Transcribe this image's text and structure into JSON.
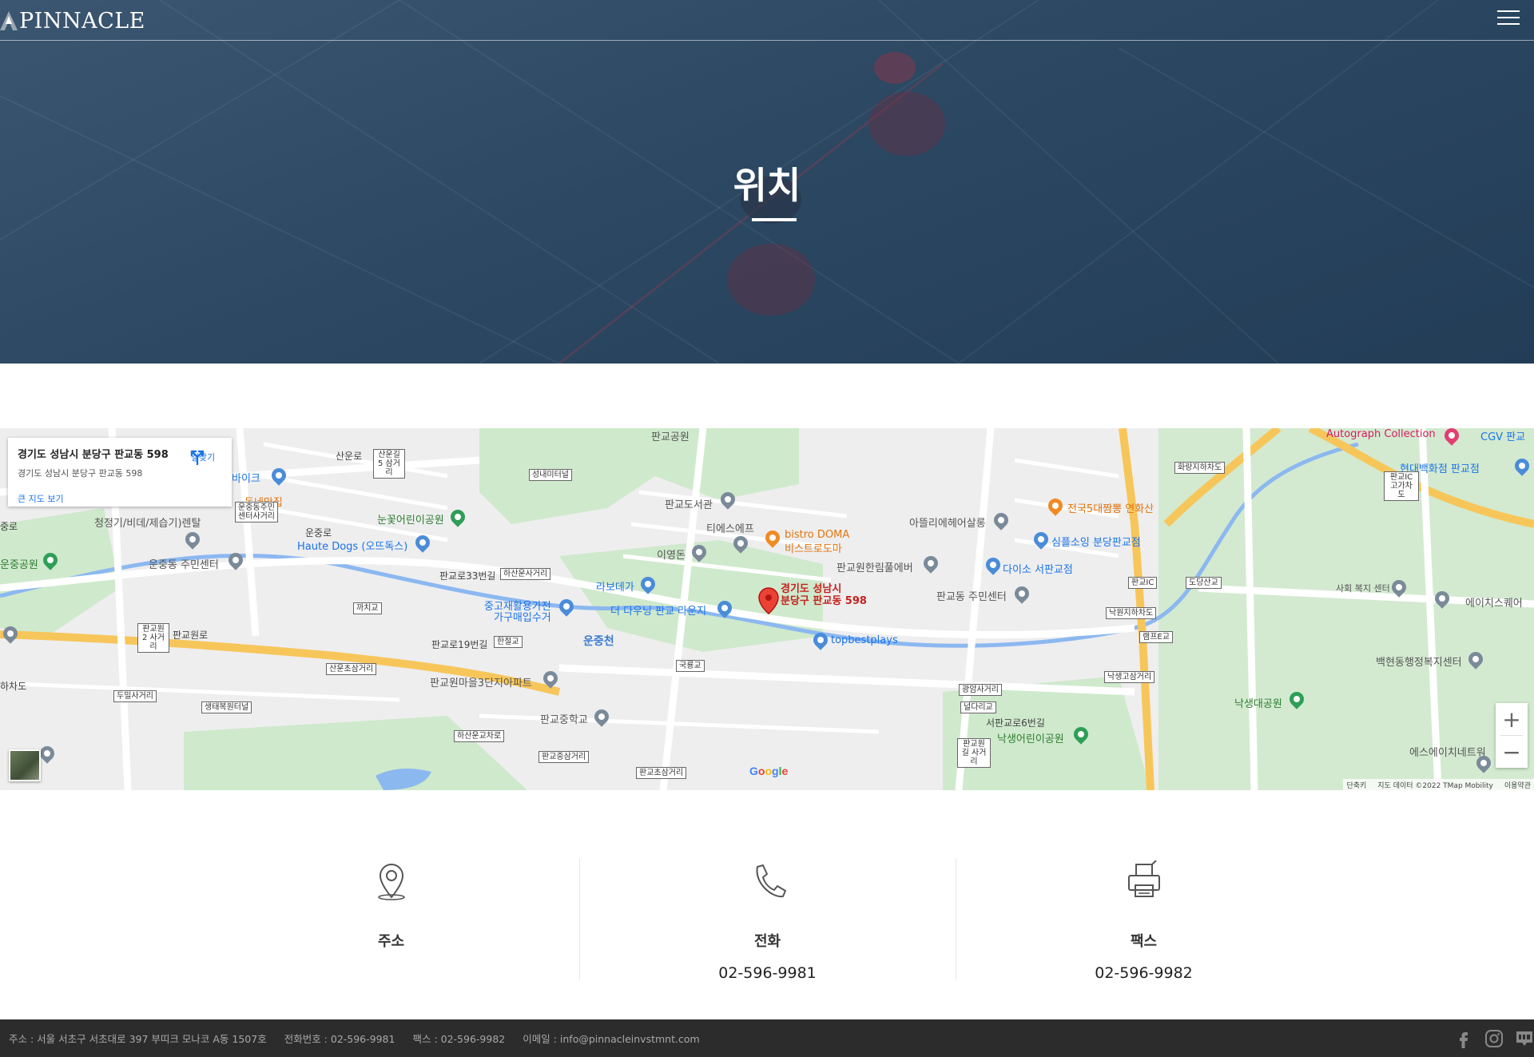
{
  "header": {
    "logo_text": "PINNACLE"
  },
  "hero": {
    "title": "위치"
  },
  "map": {
    "card": {
      "address_title": "경기도 성남시 분당구 판교동 598",
      "address_sub": "경기도 성남시 분당구 판교동 598",
      "big_map_link": "큰 지도 보기",
      "directions_label": "길찾기"
    },
    "pin_label_line1": "경기도 성남시",
    "pin_label_line2": "분당구 판교동 598",
    "google_logo": "Google",
    "attribution": {
      "shortcuts": "단축키",
      "map_data": "지도 데이터 ©2022 TMap Mobility",
      "terms": "이용약관"
    },
    "zoom_in": "+",
    "zoom_out": "−",
    "labels": [
      {
        "text": "판교공원",
        "cls": "poi"
      },
      {
        "text": "판교도서관",
        "cls": "poi"
      },
      {
        "text": "티에스에프",
        "cls": "poi"
      },
      {
        "text": "이영돈",
        "cls": "poi"
      },
      {
        "text": "라보데가",
        "cls": "blue"
      },
      {
        "text": "bistro DOMA",
        "cls": "orange"
      },
      {
        "text": "비스트로도마",
        "cls": "orange"
      },
      {
        "text": "판교원한림풀에버",
        "cls": "poi"
      },
      {
        "text": "아뜰리에헤어살롱",
        "cls": "poi"
      },
      {
        "text": "전국5대짬뽕 연화산",
        "cls": "orange"
      },
      {
        "text": "심플소잉 분당판교점",
        "cls": "blue"
      },
      {
        "text": "다이소 서판교점",
        "cls": "blue"
      },
      {
        "text": "판교동 주민센터",
        "cls": "poi"
      },
      {
        "text": "Autograph Collection",
        "cls": "pink"
      },
      {
        "text": "CGV 판교",
        "cls": "blue"
      },
      {
        "text": "현대백화점 판교점",
        "cls": "blue"
      },
      {
        "text": "사회 복지 센터",
        "cls": "poi"
      },
      {
        "text": "에이치스퀘어",
        "cls": "poi"
      },
      {
        "text": "백현동행정복지센터",
        "cls": "poi"
      },
      {
        "text": "낙생대공원",
        "cls": "green"
      },
      {
        "text": "에스에이치네트워",
        "cls": "poi"
      },
      {
        "text": "동네맛집",
        "cls": "orange"
      },
      {
        "text": "바이크",
        "cls": "blue"
      },
      {
        "text": "눈꽃어린이공원",
        "cls": "green"
      },
      {
        "text": "Haute Dogs (오뜨독스)",
        "cls": "blue"
      },
      {
        "text": "청정기/비데/제습기)렌탈",
        "cls": "poi"
      },
      {
        "text": "운중동 주민센터",
        "cls": "poi"
      },
      {
        "text": "운중공원",
        "cls": "green"
      },
      {
        "text": "중고재활용가전",
        "cls": "blue"
      },
      {
        "text": "가구매입수거",
        "cls": "blue"
      },
      {
        "text": "더 다우닝 판교 라운지",
        "cls": "blue"
      },
      {
        "text": "topbestplays",
        "cls": "blue"
      },
      {
        "text": "판교원마을3단지아파트",
        "cls": "poi"
      },
      {
        "text": "판교중학교",
        "cls": "poi"
      },
      {
        "text": "낙생어린이공원",
        "cls": "green"
      },
      {
        "text": "운중천",
        "cls": "water"
      },
      {
        "text": "산운로",
        "cls": "road"
      },
      {
        "text": "운중로",
        "cls": "road"
      },
      {
        "text": "판교로33번길",
        "cls": "road"
      },
      {
        "text": "판교로19번길",
        "cls": "road"
      },
      {
        "text": "판교원로",
        "cls": "road"
      },
      {
        "text": "서판교로6번길",
        "cls": "road"
      },
      {
        "text": "중로",
        "cls": "road"
      },
      {
        "text": "하차도",
        "cls": "road"
      }
    ],
    "boxes": [
      "산운길5 삼거리",
      "성내미터널",
      "운중동주민 센터사거리",
      "하산운사거리",
      "까치교",
      "판교원2 사거리",
      "한절교",
      "산운초삼거리",
      "두밀사거리",
      "생태복원터널",
      "하산운교차로",
      "판교중삼거리",
      "국룡교",
      "판교초삼거리",
      "화랑지하차도",
      "판교IC 고가차도",
      "판교IC",
      "도당산교",
      "낙원지하차도",
      "램프E교",
      "낙생고삼거리",
      "광암사거리",
      "널다리교",
      "판교원길 사거리"
    ]
  },
  "contact": {
    "address_label": "주소",
    "phone_label": "전화",
    "phone_value": "02-596-9981",
    "fax_label": "팩스",
    "fax_value": "02-596-9982"
  },
  "footer": {
    "address": "주소 : 서울 서초구 서초대로 397 부띠크 모나코 A동 1507호",
    "phone": "전화번호 : 02-596-9981",
    "fax": "팩스 : 02-596-9982",
    "email": "이메일 : info@pinnacleinvstmnt.com"
  },
  "colors": {
    "hero": "#2c4862",
    "footer": "#2c2c2c",
    "map_blue": "#1a73e8",
    "pin_red": "#c5221f"
  }
}
